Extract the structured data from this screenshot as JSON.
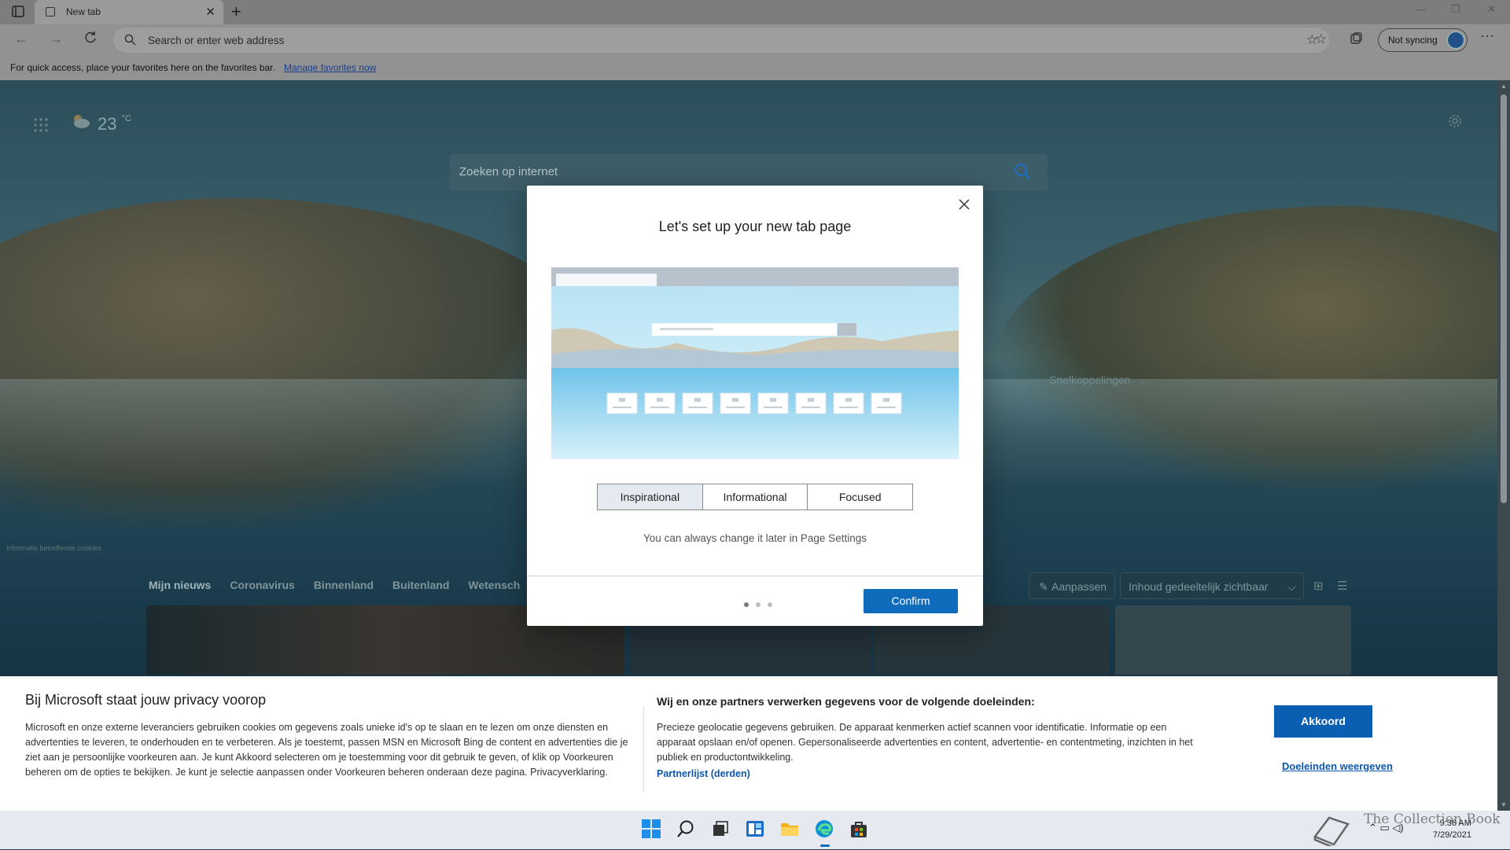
{
  "browser": {
    "tab_title": "New tab",
    "tab_close": "✕",
    "new_tab": "+",
    "address_placeholder": "Search or enter web address",
    "sync_label": "Not syncing",
    "more": "···",
    "window": {
      "minimize": "—",
      "restore": "❐",
      "close": "✕"
    }
  },
  "favorites_bar": {
    "text": "For quick access, place your favorites here on the favorites bar.",
    "link": "Manage favorites now"
  },
  "newtab": {
    "temperature": "23",
    "temp_unit": "°C",
    "search_placeholder": "Zoeken op internet",
    "shortcuts_label": "Snelkoppelingen",
    "cookie_info": "Informatie betreffende cookies",
    "news_tabs": [
      "Mijn nieuws",
      "Coronavirus",
      "Binnenland",
      "Buitenland",
      "Wetensch"
    ],
    "customize": "Aanpassen",
    "visibility": "Inhoud gedeeltelijk zichtbaar"
  },
  "modal": {
    "title": "Let's set up your new tab page",
    "options": [
      "Inspirational",
      "Informational",
      "Focused"
    ],
    "selected_option": "Inspirational",
    "hint": "You can always change it later in Page Settings",
    "step": 1,
    "total_steps": 3,
    "confirm": "Confirm"
  },
  "privacy": {
    "title": "Bij Microsoft staat jouw privacy voorop",
    "body": "Microsoft en onze externe leveranciers gebruiken cookies om gegevens zoals unieke id's op te slaan en te lezen om onze diensten en advertenties te leveren, te onderhouden en te verbeteren. Als je toestemt, passen MSN en Microsoft Bing de content en advertenties die je ziet aan je persoonlijke voorkeuren aan. Je kunt Akkoord selecteren om je toestemming voor dit gebruik te geven, of klik op Voorkeuren beheren om de opties te bekijken. Je kunt je selectie aanpassen onder Voorkeuren beheren onderaan deze pagina.",
    "privacy_link": "Privacyverklaring.",
    "purposes_title": "Wij en onze partners verwerken gegevens voor de volgende doeleinden:",
    "purposes_body": "Precieze geolocatie gegevens gebruiken. De apparaat kenmerken actief scannen voor identificatie. Informatie op een apparaat opslaan en/of openen. Gepersonaliseerde advertenties en content, advertentie- en contentmeting, inzichten in het publiek en productontwikkeling.",
    "partners_link": "Partnerlijst (derden)",
    "accept": "Akkoord",
    "purposes_link": "Doeleinden weergeven"
  },
  "taskbar": {
    "time": "9:36 AM",
    "date": "7/29/2021",
    "watermark": "The Collection Book"
  },
  "colors": {
    "accent": "#0f6cbd",
    "link": "#0b57b0"
  }
}
